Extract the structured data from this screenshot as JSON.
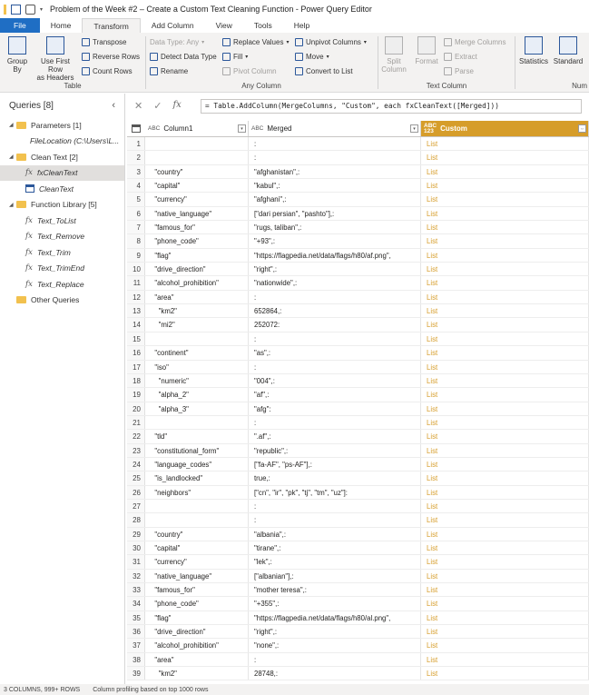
{
  "window": {
    "title": "Problem of the Week #2 – Create a Custom Text Cleaning Function - Power Query Editor"
  },
  "tabs": [
    "File",
    "Home",
    "Transform",
    "Add Column",
    "View",
    "Tools",
    "Help"
  ],
  "ribbon": {
    "table_group": {
      "label": "Table",
      "group_by": "Group\nBy",
      "use_first_row": "Use First Row\nas Headers",
      "transpose": "Transpose",
      "reverse_rows": "Reverse Rows",
      "count_rows": "Count Rows"
    },
    "any_column_group": {
      "label": "Any Column",
      "data_type": "Data Type: Any",
      "detect_data_type": "Detect Data Type",
      "rename": "Rename",
      "replace_values": "Replace Values",
      "fill": "Fill",
      "pivot_column": "Pivot Column",
      "unpivot_columns": "Unpivot Columns",
      "move": "Move",
      "convert_to_list": "Convert to List"
    },
    "text_column_group": {
      "label": "Text Column",
      "split_column": "Split\nColumn",
      "format": "Format",
      "merge_columns": "Merge Columns",
      "extract": "Extract",
      "parse": "Parse"
    },
    "number_group": {
      "label": "Num",
      "statistics": "Statistics",
      "standard": "Standard"
    }
  },
  "queries": {
    "header": "Queries [8]",
    "items": [
      {
        "label": "Parameters [1]",
        "type": "folder",
        "indent": 0
      },
      {
        "label": "FileLocation (C:\\Users\\L...",
        "type": "param",
        "indent": 1
      },
      {
        "label": "Clean Text [2]",
        "type": "folder",
        "indent": 0
      },
      {
        "label": "fxCleanText",
        "type": "function",
        "indent": 1,
        "selected": true
      },
      {
        "label": "CleanText",
        "type": "table",
        "indent": 1
      },
      {
        "label": "Function Library [5]",
        "type": "folder",
        "indent": 0
      },
      {
        "label": "Text_ToList",
        "type": "function",
        "indent": 1
      },
      {
        "label": "Text_Remove",
        "type": "function",
        "indent": 1
      },
      {
        "label": "Text_Trim",
        "type": "function",
        "indent": 1
      },
      {
        "label": "Text_TrimEnd",
        "type": "function",
        "indent": 1
      },
      {
        "label": "Text_Replace",
        "type": "function",
        "indent": 1
      },
      {
        "label": "Other Queries",
        "type": "folder",
        "indent": 0
      }
    ]
  },
  "formula_bar": {
    "formula": "= Table.AddColumn(MergeColumns, \"Custom\", each fxCleanText([Merged]))"
  },
  "grid": {
    "columns": [
      {
        "name": "Column1",
        "type": "ABC"
      },
      {
        "name": "Merged",
        "type": "ABC"
      },
      {
        "name": "Custom",
        "type": "ABC\n123"
      }
    ],
    "rows": [
      [
        "",
        ":",
        "List"
      ],
      [
        "",
        ":",
        "List"
      ],
      [
        "  \"country\"",
        "\"afghanistan\",:",
        "List"
      ],
      [
        "  \"capital\"",
        "\"kabul\",:",
        "List"
      ],
      [
        "  \"currency\"",
        "\"afghani\",:",
        "List"
      ],
      [
        "  \"native_language\"",
        "[\"dari persian\", \"pashto\"],:",
        "List"
      ],
      [
        "  \"famous_for\"",
        "\"rugs, taliban\",:",
        "List"
      ],
      [
        "  \"phone_code\"",
        "\"+93\",:",
        "List"
      ],
      [
        "  \"flag\"",
        "\"https://flagpedia.net/data/flags/h80/af.png\",",
        "List"
      ],
      [
        "  \"drive_direction\"",
        "\"right\",:",
        "List"
      ],
      [
        "  \"alcohol_prohibition\"",
        "\"nationwide\",:",
        "List"
      ],
      [
        "  \"area\"",
        ":",
        "List"
      ],
      [
        "    \"km2\"",
        "652864,:",
        "List"
      ],
      [
        "    \"mi2\"",
        "252072:",
        "List"
      ],
      [
        "",
        ":",
        "List"
      ],
      [
        "  \"continent\"",
        "\"as\",:",
        "List"
      ],
      [
        "  \"iso\"",
        ":",
        "List"
      ],
      [
        "    \"numeric\"",
        "\"004\",:",
        "List"
      ],
      [
        "    \"alpha_2\"",
        "\"af\",:",
        "List"
      ],
      [
        "    \"alpha_3\"",
        "\"afg\":",
        "List"
      ],
      [
        "",
        ":",
        "List"
      ],
      [
        "  \"tld\"",
        "\".af\",:",
        "List"
      ],
      [
        "  \"constitutional_form\"",
        "\"republic\",:",
        "List"
      ],
      [
        "  \"language_codes\"",
        "[\"fa-AF\", \"ps-AF\"],:",
        "List"
      ],
      [
        "  \"is_landlocked\"",
        "true,:",
        "List"
      ],
      [
        "  \"neighbors\"",
        "[\"cn\", \"ir\", \"pk\", \"tj\", \"tm\", \"uz\"]:",
        "List"
      ],
      [
        "",
        ":",
        "List"
      ],
      [
        "",
        ":",
        "List"
      ],
      [
        "  \"country\"",
        "\"albania\",:",
        "List"
      ],
      [
        "  \"capital\"",
        "\"tirane\",:",
        "List"
      ],
      [
        "  \"currency\"",
        "\"lek\",:",
        "List"
      ],
      [
        "  \"native_language\"",
        "[\"albanian\"],:",
        "List"
      ],
      [
        "  \"famous_for\"",
        "\"mother teresa\",:",
        "List"
      ],
      [
        "  \"phone_code\"",
        "\"+355\",:",
        "List"
      ],
      [
        "  \"flag\"",
        "\"https://flagpedia.net/data/flags/h80/al.png\",",
        "List"
      ],
      [
        "  \"drive_direction\"",
        "\"right\",:",
        "List"
      ],
      [
        "  \"alcohol_prohibition\"",
        "\"none\",:",
        "List"
      ],
      [
        "  \"area\"",
        ":",
        "List"
      ],
      [
        "    \"km2\"",
        "28748,:",
        "List"
      ]
    ]
  },
  "status_bar": {
    "summary": "3 COLUMNS, 999+ ROWS",
    "profiling": "Column profiling based on top 1000 rows"
  }
}
